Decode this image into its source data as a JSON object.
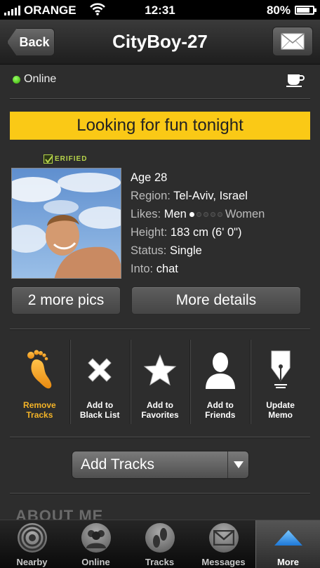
{
  "status_bar": {
    "carrier": "ORANGE",
    "time": "12:31",
    "battery": "80%",
    "battery_level": 0.8
  },
  "nav": {
    "back_label": "Back",
    "title": "CityBoy-27"
  },
  "presence": {
    "status": "Online",
    "status_color": "#44cc22"
  },
  "headline": {
    "text": "Looking for fun tonight",
    "bg_color": "#fac916"
  },
  "profile": {
    "verified_label": "ERIFIED",
    "age": "Age 28",
    "region_key": "Region:",
    "region_value": "Tel-Aviv, Israel",
    "likes_key": "Likes:",
    "likes_left": "Men",
    "likes_right": "Women",
    "likes_scale": {
      "selected": 1,
      "of": 5
    },
    "height_key": "Height:",
    "height_value": "183 cm (6' 0\")",
    "status_key": "Status:",
    "status_value": "Single",
    "into_key": "Into:",
    "into_value": "chat"
  },
  "buttons": {
    "more_pics": "2 more pics",
    "more_details": "More details"
  },
  "actions": [
    {
      "icon": "footprint-icon",
      "line1": "Remove",
      "line2": "Tracks",
      "active": true
    },
    {
      "icon": "x-icon",
      "line1": "Add to",
      "line2": "Black List",
      "active": false
    },
    {
      "icon": "star-icon",
      "line1": "Add to",
      "line2": "Favorites",
      "active": false
    },
    {
      "icon": "person-icon",
      "line1": "Add to",
      "line2": "Friends",
      "active": false
    },
    {
      "icon": "pen-icon",
      "line1": "Update",
      "line2": "Memo",
      "active": false
    }
  ],
  "select": {
    "value": "Add Tracks"
  },
  "about_heading": "ABOUT ME",
  "tabs": [
    {
      "label": "Nearby",
      "icon": "radar-icon"
    },
    {
      "label": "Online",
      "icon": "people-icon"
    },
    {
      "label": "Tracks",
      "icon": "footprints-icon"
    },
    {
      "label": "Messages",
      "icon": "envelope-icon"
    },
    {
      "label": "More",
      "icon": "up-arrow-icon",
      "selected": true
    }
  ],
  "colors": {
    "accent_orange": "#f3b327",
    "verified_green": "#b6d34a"
  }
}
